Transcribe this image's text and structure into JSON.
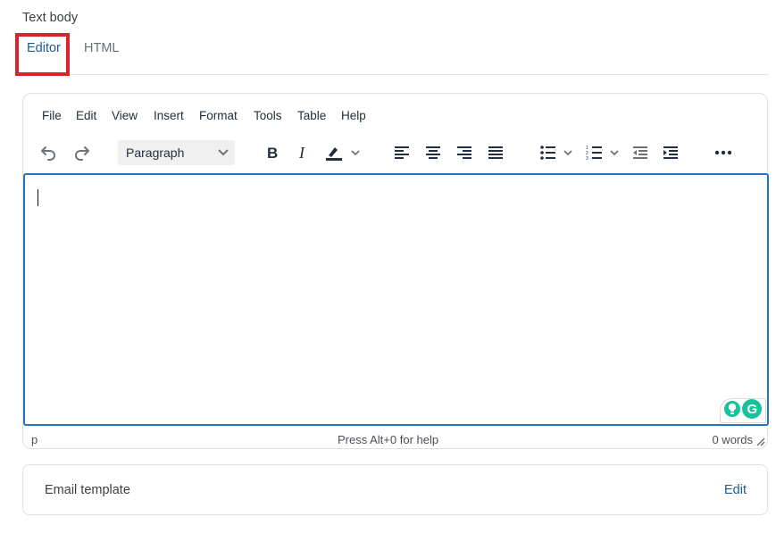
{
  "field_label": "Text body",
  "tabs": [
    {
      "label": "Editor",
      "active": true
    },
    {
      "label": "HTML",
      "active": false
    }
  ],
  "menubar": [
    "File",
    "Edit",
    "View",
    "Insert",
    "Format",
    "Tools",
    "Table",
    "Help"
  ],
  "toolbar": {
    "block_format": "Paragraph",
    "icons": [
      "undo-icon",
      "redo-icon",
      "bold-icon",
      "italic-icon",
      "highlight-icon",
      "align-left-icon",
      "align-center-icon",
      "align-right-icon",
      "align-justify-icon",
      "bullet-list-icon",
      "numbered-list-icon",
      "outdent-icon",
      "indent-icon",
      "more-icon"
    ]
  },
  "statusbar": {
    "path": "p",
    "help": "Press Alt+0 for help",
    "word_count": "0 words"
  },
  "email_template": {
    "label": "Email template",
    "action": "Edit"
  },
  "colors": {
    "accent": "#1d5d8f",
    "focus_border": "#2672c7",
    "highlight": "#e0202a",
    "grammarly": "#15c39a"
  }
}
